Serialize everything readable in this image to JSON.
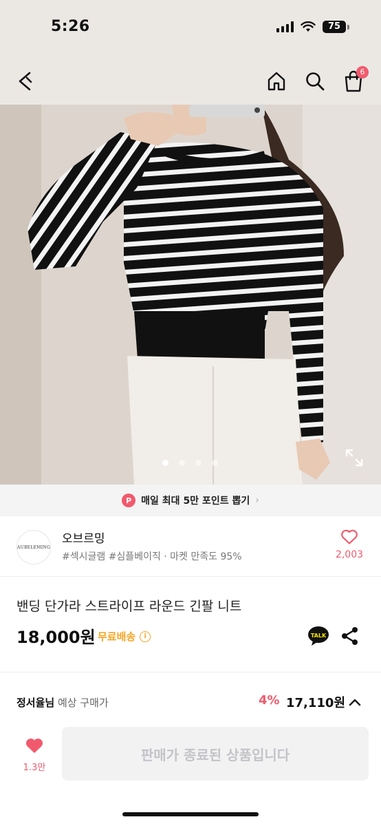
{
  "status_bar": {
    "time": "5:26",
    "battery": "75"
  },
  "nav": {
    "cart_count": "6"
  },
  "image": {
    "current_index": 1,
    "total": 4
  },
  "banner": {
    "badge": "P",
    "text": "매일 최대 5만 포인트 뽑기",
    "chevron": "›"
  },
  "shop": {
    "logo_text": "AUBELEMING",
    "name": "오브르밍",
    "tags": "#섹시글램 #심플베이직 · 마켓 만족도 95%",
    "like_count": "2,003"
  },
  "product": {
    "title": "밴딩 단가라 스트라이프 라운드 긴팔 니트",
    "price": "18,000원",
    "shipping": "무료배송",
    "info_icon": "i",
    "talk_label": "TALK"
  },
  "estimate": {
    "name": "정서율님",
    "label": " 예상 구매가",
    "percent": "4%",
    "price": "17,110원"
  },
  "bottom": {
    "wish_count": "1.3만",
    "buy_label": "판매가 종료된 상품입니다"
  },
  "colors": {
    "accent": "#f15a6d",
    "shipping": "#f5a623"
  },
  "icons": [
    "back-icon",
    "home-icon",
    "search-icon",
    "cart-icon",
    "expand-icon",
    "info-icon",
    "kakao-talk-icon",
    "share-icon",
    "chevron-up-icon",
    "heart-icon"
  ]
}
